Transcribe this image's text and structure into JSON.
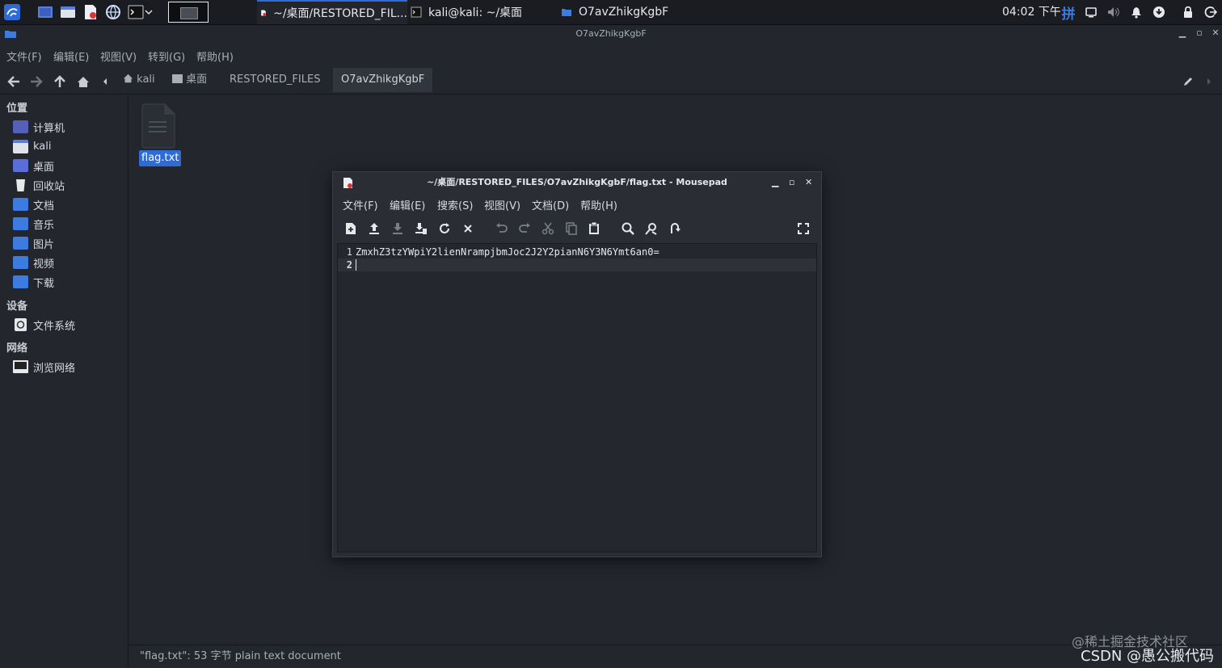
{
  "panel": {
    "tasks": [
      {
        "label": "~/桌面/RESTORED_FIL..."
      },
      {
        "label": "kali@kali: ~/桌面"
      },
      {
        "label": "O7avZhikgKgbF"
      }
    ],
    "clock": "04:02 下午",
    "ime": "拼"
  },
  "thunar": {
    "title": "O7avZhikgKgbF",
    "menu": [
      "文件(F)",
      "编辑(E)",
      "视图(V)",
      "转到(G)",
      "帮助(H)"
    ],
    "breadcrumbs": [
      "kali",
      "桌面",
      "RESTORED_FILES",
      "O7avZhikgKgbF"
    ],
    "sidebar": {
      "places_header": "位置",
      "places": [
        "计算机",
        "kali",
        "桌面",
        "回收站",
        "文档",
        "音乐",
        "图片",
        "视频",
        "下载"
      ],
      "devices_header": "设备",
      "devices": [
        "文件系统"
      ],
      "network_header": "网络",
      "network": [
        "浏览网络"
      ]
    },
    "file": {
      "name": "flag.txt"
    },
    "status": "\"flag.txt\": 53 字节 plain text document"
  },
  "mousepad": {
    "title": "~/桌面/RESTORED_FILES/O7avZhikgKgbF/flag.txt - Mousepad",
    "menu": [
      "文件(F)",
      "编辑(E)",
      "搜索(S)",
      "视图(V)",
      "文档(D)",
      "帮助(H)"
    ],
    "lines": [
      {
        "num": "1",
        "text": "ZmxhZ3tzYWpiY2lienNrampjbmJoc2J2Y2pianN6Y3N6Ymt6an0="
      },
      {
        "num": "2",
        "text": ""
      }
    ]
  },
  "watermark": {
    "line1": "@稀土掘金技术社区",
    "line2": "CSDN @愚公搬代码"
  },
  "colors": {
    "accent": "#2f6bd6",
    "folder": "#3d7be0"
  }
}
